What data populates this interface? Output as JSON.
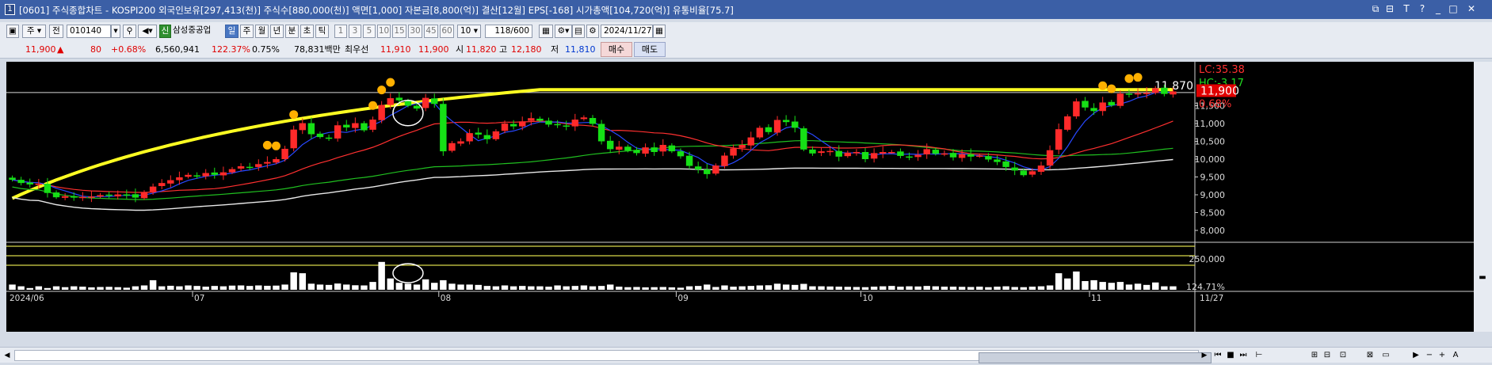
{
  "window": {
    "number": "1",
    "title": "[0601] 주식종합차트 - KOSPI200 외국인보유[297,413(천)] 주식수[880,000(천)] 액면[1,000] 자본금[8,800(억)] 결산[12월] EPS[-168] 시가총액[104,720(억)] 유통비율[75.7]",
    "controls": [
      "⧉",
      "⊟",
      "T",
      "?",
      "_",
      "□",
      "✕"
    ]
  },
  "toolbar": {
    "market_select": "주",
    "prev_label": "전",
    "code": "010140",
    "company_badge": "신",
    "company_name": "삼성중공업",
    "periods": [
      "일",
      "주",
      "월",
      "년",
      "분",
      "초",
      "틱"
    ],
    "active_period": "일",
    "minutes": [
      "1",
      "3",
      "5",
      "10",
      "15",
      "30",
      "45",
      "60"
    ],
    "count_select": "10",
    "range": "118/600",
    "date": "2024/11/27"
  },
  "quote": {
    "price": "11,900",
    "direction": "▲",
    "change": "80",
    "change_pct": "+0.68%",
    "volume": "6,560,941",
    "volume_ratio": "122.37%",
    "turnover": "0.75%",
    "amount": "78,831백만",
    "best_label": "최우선",
    "ask": "11,910",
    "bid": "11,900",
    "open_label": "시",
    "open": "11,820",
    "high_label": "고",
    "high": "12,180",
    "low_label": "저",
    "low": "11,810",
    "buy_label": "매수",
    "sell_label": "매도"
  },
  "chart_data": {
    "type": "candlestick",
    "period": "2024/06 - 2024/11/27",
    "x_month_labels": [
      "2024/06",
      "07",
      "08",
      "09",
      "10",
      "11"
    ],
    "x_end_label": "11/27",
    "ylim": [
      7800,
      12600
    ],
    "price_ticks": [
      "11,500",
      "11,000",
      "10,500",
      "10,000",
      "9,500",
      "9,000",
      "8,500",
      "8,000"
    ],
    "current_price_label": "11,900",
    "change_pct_label": "0.68%",
    "reference_line_label": "11,870",
    "reference_line_value": 11870,
    "lc_label": "LC:35.38",
    "hc_label": "HC:-3.17",
    "volume_tick_labels": [
      "250,000",
      "124.71%"
    ],
    "colors": {
      "up": "#ff2a2a",
      "down": "#16e016",
      "ma_long": "#ffff22",
      "ma5": "#2848ff",
      "ma20": "#ff3030",
      "ma60": "#20c020",
      "ma120": "#e8e8e8",
      "marker": "#ffb000"
    },
    "closes": [
      9420,
      9330,
      9290,
      9310,
      9050,
      8930,
      8960,
      8920,
      8940,
      8950,
      8990,
      8970,
      9010,
      9000,
      8920,
      9070,
      9230,
      9330,
      9410,
      9490,
      9560,
      9520,
      9610,
      9560,
      9630,
      9720,
      9800,
      9780,
      9860,
      9920,
      10000,
      10290,
      10830,
      11010,
      10700,
      10620,
      10580,
      10950,
      10890,
      11010,
      10810,
      11110,
      11520,
      11710,
      11650,
      11500,
      11420,
      11720,
      11550,
      10220,
      10450,
      10500,
      10730,
      10690,
      10560,
      10780,
      11000,
      10920,
      11060,
      11150,
      11080,
      10970,
      10960,
      10920,
      11110,
      11170,
      10990,
      10500,
      10280,
      10350,
      10240,
      10170,
      10330,
      10200,
      10400,
      10220,
      10080,
      9810,
      9710,
      9580,
      9820,
      10100,
      10300,
      10400,
      10610,
      10880,
      10760,
      11100,
      11040,
      10880,
      10270,
      10160,
      10220,
      10230,
      10070,
      10180,
      10200,
      10000,
      10170,
      10200,
      10200,
      10090,
      10060,
      10120,
      10280,
      10150,
      10160,
      10050,
      10140,
      10070,
      10100,
      9990,
      9920,
      9780,
      9680,
      9550,
      9660,
      9820,
      10250,
      10840,
      11200,
      11620,
      11450,
      11350,
      11590,
      11510,
      11840,
      11820,
      11850,
      11860,
      11990,
      11830,
      11900
    ],
    "volume_scale": [
      0.3,
      0.2,
      0.1,
      0.2,
      0.1,
      0.2,
      0.15,
      0.2,
      0.18,
      0.14,
      0.16,
      0.17,
      0.15,
      0.12,
      0.2,
      0.25,
      0.55,
      0.2,
      0.23,
      0.2,
      0.25,
      0.22,
      0.18,
      0.22,
      0.2,
      0.24,
      0.25,
      0.22,
      0.25,
      0.23,
      0.24,
      0.3,
      1.0,
      0.95,
      0.35,
      0.3,
      0.28,
      0.36,
      0.3,
      0.26,
      0.25,
      0.45,
      1.6,
      0.65,
      0.4,
      0.35,
      0.3,
      0.6,
      0.4,
      0.55,
      0.35,
      0.3,
      0.3,
      0.28,
      0.22,
      0.2,
      0.25,
      0.2,
      0.22,
      0.2,
      0.2,
      0.18,
      0.25,
      0.2,
      0.22,
      0.25,
      0.2,
      0.22,
      0.3,
      0.18,
      0.15,
      0.16,
      0.14,
      0.15,
      0.16,
      0.14,
      0.12,
      0.2,
      0.22,
      0.3,
      0.16,
      0.25,
      0.18,
      0.2,
      0.22,
      0.25,
      0.26,
      0.35,
      0.3,
      0.28,
      0.34,
      0.2,
      0.2,
      0.19,
      0.18,
      0.17,
      0.16,
      0.15,
      0.18,
      0.2,
      0.22,
      0.18,
      0.2,
      0.19,
      0.22,
      0.2,
      0.18,
      0.18,
      0.17,
      0.16,
      0.18,
      0.15,
      0.18,
      0.2,
      0.16,
      0.15,
      0.18,
      0.2,
      0.25,
      0.95,
      0.65,
      1.05,
      0.5,
      0.55,
      0.45,
      0.4,
      0.45,
      0.3,
      0.35,
      0.28,
      0.42,
      0.2,
      0.2
    ],
    "markers_above_bar_index": [
      29,
      30,
      32,
      41,
      42,
      43,
      124,
      125,
      127,
      128
    ]
  }
}
